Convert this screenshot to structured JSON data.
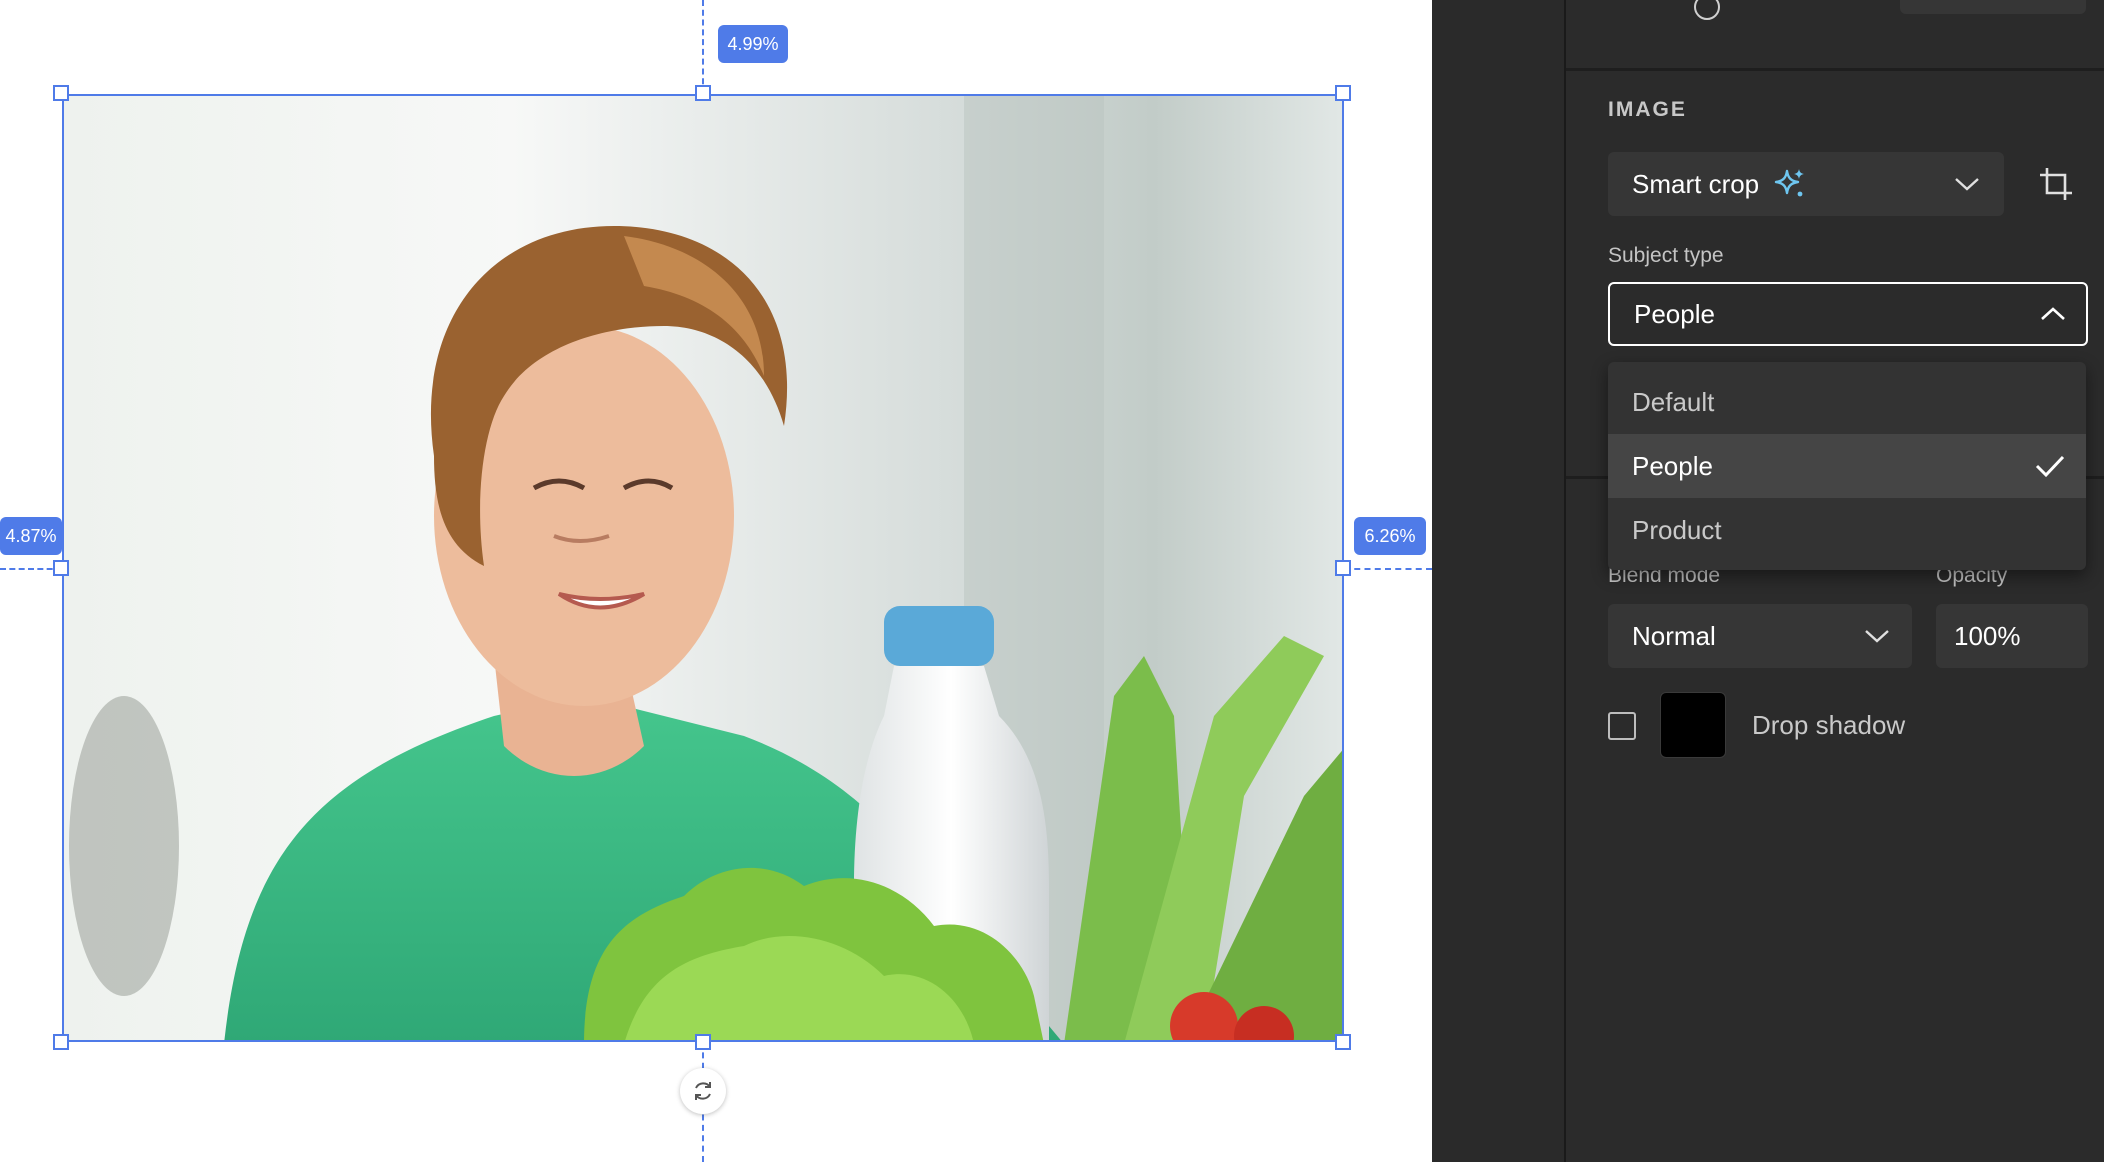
{
  "canvas": {
    "badge_top": "4.99%",
    "badge_left": "4.87%",
    "badge_right": "6.26%"
  },
  "panel": {
    "section_title": "IMAGE",
    "crop_mode": {
      "value": "Smart crop",
      "icon": "sparkle-icon"
    },
    "subject_type": {
      "label": "Subject type",
      "value": "People",
      "options": [
        {
          "label": "Default",
          "selected": false
        },
        {
          "label": "People",
          "selected": true
        },
        {
          "label": "Product",
          "selected": false
        }
      ]
    },
    "blend_mode": {
      "label": "Blend mode",
      "value": "Normal"
    },
    "opacity": {
      "label": "Opacity",
      "value": "100%"
    },
    "drop_shadow": {
      "label": "Drop shadow",
      "checked": false,
      "color": "#000000"
    }
  },
  "colors": {
    "selection": "#4f7be8",
    "panel_bg": "#2b2b2b",
    "field_bg": "#363636",
    "sparkle": "#6ec6f0"
  }
}
